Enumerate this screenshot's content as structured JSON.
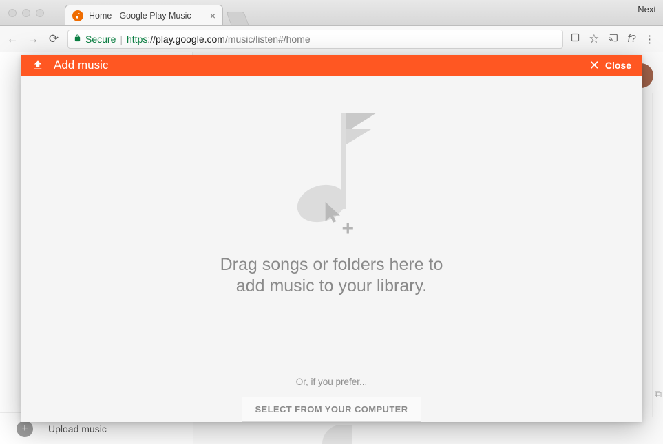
{
  "browser": {
    "tab_title": "Home - Google Play Music",
    "next_label": "Next",
    "secure_label": "Secure",
    "url_protocol": "https",
    "url_host": "://play.google.com",
    "url_path": "/music/listen#/home"
  },
  "background": {
    "upload_music_label": "Upload music"
  },
  "modal": {
    "title": "Add music",
    "close_label": "Close",
    "drop_line1": "Drag songs or folders here to",
    "drop_line2": "add music to your library.",
    "or_label": "Or, if you prefer...",
    "select_button_label": "SELECT FROM YOUR COMPUTER"
  },
  "colors": {
    "accent": "#ff5722",
    "secure": "#0b8043"
  }
}
